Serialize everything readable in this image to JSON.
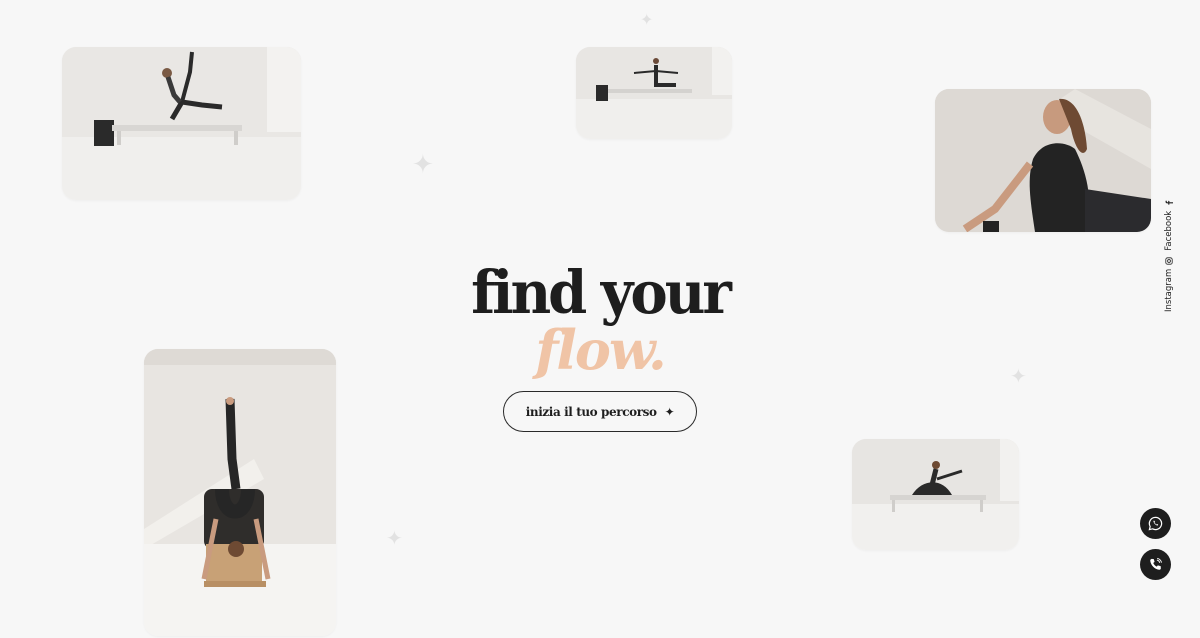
{
  "hero": {
    "line1": "find your",
    "line2": "flow.",
    "cta_label": "inizia il tuo percorso",
    "cta_icon": "sparkle-icon"
  },
  "social": {
    "instagram_label": "Instagram",
    "facebook_label": "Facebook"
  },
  "colors": {
    "background": "#f7f7f7",
    "text": "#1e1e1e",
    "accent": "#f0c4a6",
    "fab": "#1e1e1e"
  },
  "floating_buttons": [
    "whatsapp-icon",
    "phone-icon"
  ],
  "photos": [
    "pilates-reformer-photo",
    "pilates-reformer-small-photo",
    "stretch-portrait-photo",
    "wunda-chair-photo",
    "reformer-stretch-photo"
  ]
}
